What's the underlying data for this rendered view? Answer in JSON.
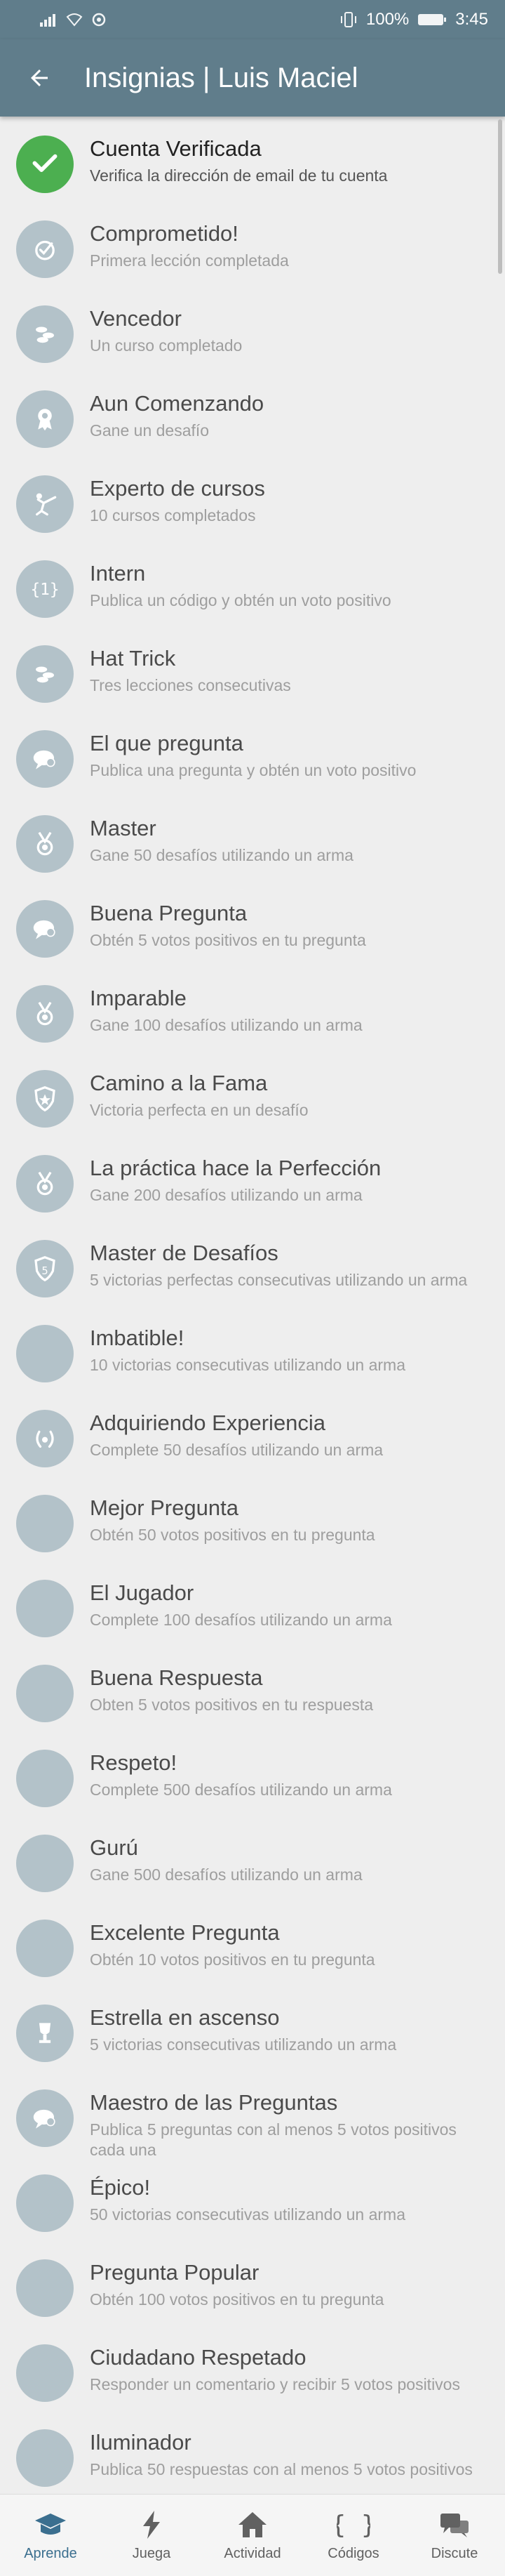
{
  "status_bar": {
    "battery_percent": "100%",
    "time": "3:45"
  },
  "app_bar": {
    "title": "Insignias | Luis Maciel"
  },
  "badges": [
    {
      "title": "Cuenta Verificada",
      "description": "Verifica la dirección de email de tu cuenta",
      "earned": true,
      "icon": "check-icon"
    },
    {
      "title": "Comprometido!",
      "description": "Primera lección completada",
      "earned": false,
      "icon": "check-circle-icon"
    },
    {
      "title": "Vencedor",
      "description": "Un curso completado",
      "earned": false,
      "icon": "coins-icon"
    },
    {
      "title": "Aun Comenzando",
      "description": "Gane un desafío",
      "earned": false,
      "icon": "ribbon-medal-icon"
    },
    {
      "title": "Experto de cursos",
      "description": "10 cursos completados",
      "earned": false,
      "icon": "fencer-icon"
    },
    {
      "title": "Intern",
      "description": "Publica un código y obtén un voto positivo",
      "earned": false,
      "icon": "code-brackets-icon"
    },
    {
      "title": "Hat Trick",
      "description": "Tres lecciones consecutivas",
      "earned": false,
      "icon": "coins-icon"
    },
    {
      "title": "El que pregunta",
      "description": "Publica una pregunta y obtén un voto positivo",
      "earned": false,
      "icon": "speech-bubble-icon"
    },
    {
      "title": "Master",
      "description": "Gane 50 desafíos utilizando un arma",
      "earned": false,
      "icon": "medal-icon"
    },
    {
      "title": "Buena Pregunta",
      "description": "Obtén 5 votos positivos en tu pregunta",
      "earned": false,
      "icon": "speech-bubble-icon"
    },
    {
      "title": "Imparable",
      "description": "Gane 100 desafíos utilizando un arma",
      "earned": false,
      "icon": "medal-icon"
    },
    {
      "title": "Camino a la Fama",
      "description": "Victoria perfecta en un desafío",
      "earned": false,
      "icon": "shield-star-icon"
    },
    {
      "title": "La práctica hace la Perfección",
      "description": "Gane 200 desafíos utilizando un arma",
      "earned": false,
      "icon": "medal-icon"
    },
    {
      "title": "Master de Desafíos",
      "description": "5 victorias perfectas consecutivas utilizando un arma",
      "earned": false,
      "icon": "shield-five-icon"
    },
    {
      "title": "Imbatible!",
      "description": "10 victorias consecutivas utilizando un arma",
      "earned": false,
      "icon": ""
    },
    {
      "title": "Adquiriendo Experiencia",
      "description": "Complete 50 desafíos utilizando un arma",
      "earned": false,
      "icon": "laurel-icon"
    },
    {
      "title": "Mejor Pregunta",
      "description": "Obtén 50 votos positivos en tu pregunta",
      "earned": false,
      "icon": ""
    },
    {
      "title": "El Jugador",
      "description": "Complete 100 desafíos utilizando un arma",
      "earned": false,
      "icon": ""
    },
    {
      "title": "Buena Respuesta",
      "description": "Obten 5 votos positivos en tu respuesta",
      "earned": false,
      "icon": ""
    },
    {
      "title": "Respeto!",
      "description": "Complete 500 desafíos utilizando un arma",
      "earned": false,
      "icon": ""
    },
    {
      "title": "Gurú",
      "description": "Gane 500 desafíos utilizando un arma",
      "earned": false,
      "icon": ""
    },
    {
      "title": "Excelente Pregunta",
      "description": "Obtén 10 votos positivos en tu pregunta",
      "earned": false,
      "icon": ""
    },
    {
      "title": "Estrella en ascenso",
      "description": "5 victorias consecutivas utilizando un arma",
      "earned": false,
      "icon": "trophy-icon"
    },
    {
      "title": "Maestro de las Preguntas",
      "description": "Publica 5 preguntas con al menos 5 votos positivos cada una",
      "earned": false,
      "icon": "speech-bubble-icon"
    },
    {
      "title": "Épico!",
      "description": "50 victorias consecutivas utilizando un arma",
      "earned": false,
      "icon": ""
    },
    {
      "title": "Pregunta Popular",
      "description": "Obtén 100 votos positivos en tu pregunta",
      "earned": false,
      "icon": ""
    },
    {
      "title": "Ciudadano Respetado",
      "description": "Responder un comentario y recibir 5 votos positivos",
      "earned": false,
      "icon": ""
    },
    {
      "title": "Iluminador",
      "description": "Publica 50 respuestas con al menos 5 votos positivos",
      "earned": false,
      "icon": ""
    }
  ],
  "bottom_nav": [
    {
      "label": "Aprende",
      "icon": "graduation-cap-icon",
      "active": true
    },
    {
      "label": "Juega",
      "icon": "lightning-icon",
      "active": false
    },
    {
      "label": "Actividad",
      "icon": "home-icon",
      "active": false
    },
    {
      "label": "Códigos",
      "icon": "curly-braces-icon",
      "active": false
    },
    {
      "label": "Discute",
      "icon": "chat-bubbles-icon",
      "active": false
    }
  ],
  "colors": {
    "app_bar": "#607d8b",
    "earned_badge": "#4caf50",
    "unearned_badge": "#b3c2c9",
    "active_nav": "#3b6f8f"
  }
}
